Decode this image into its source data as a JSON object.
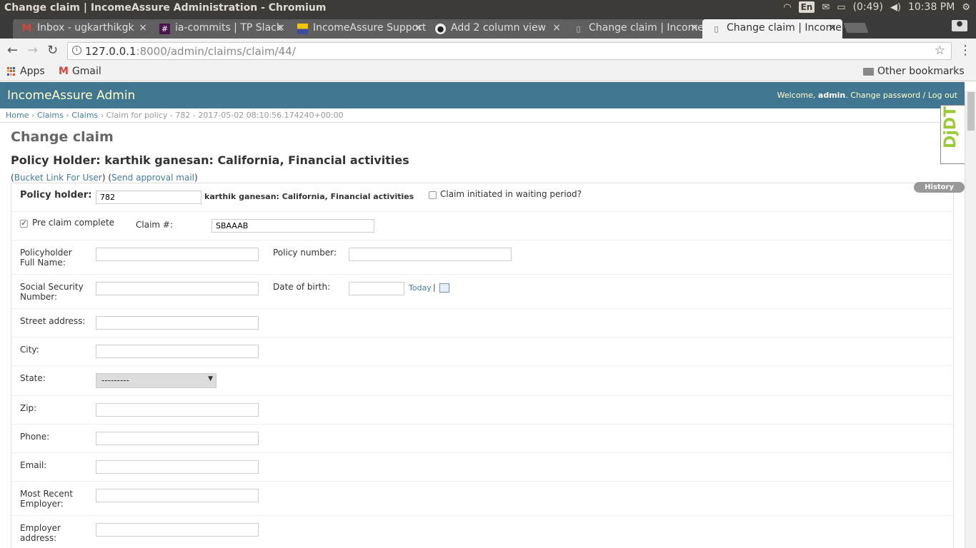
{
  "os": {
    "window_title": "Change claim | IncomeAssure Administration - Chromium",
    "lang": "En",
    "battery": "(0:49)",
    "clock": "10:38 PM"
  },
  "tabs": [
    {
      "label": "Inbox - ugkarthikgk",
      "icon": "gmail-icon"
    },
    {
      "label": "ia-commits | TP Slack",
      "icon": "slack-icon"
    },
    {
      "label": "IncomeAssure Support",
      "icon": "flag-icon"
    },
    {
      "label": "Add 2 column view",
      "icon": "github-icon"
    },
    {
      "label": "Change claim | Income",
      "icon": "page-icon"
    },
    {
      "label": "Change claim | Income",
      "icon": "page-icon"
    }
  ],
  "address": {
    "host": "127.0.0.1",
    "path": ":8000/admin/claims/claim/44/"
  },
  "bookmarks": {
    "apps": "Apps",
    "gmail": "Gmail",
    "other": "Other bookmarks"
  },
  "admin": {
    "brand": "IncomeAssure Admin",
    "welcome": "Welcome, ",
    "username": "admin",
    "change_password": "Change password",
    "sep": " / ",
    "logout": "Log out"
  },
  "breadcrumbs": {
    "home": "Home",
    "claims_app": "Claims",
    "claims_model": "Claims",
    "current": "Claim for policy - 782 - 2017-05-02 08:10:56.174240+00:00"
  },
  "page": {
    "title": "Change claim",
    "subtitle": "Policy Holder: karthik ganesan: California, Financial activities",
    "bucket_link": "Bucket Link For User",
    "approval_link": "Send approval mail",
    "history": "History"
  },
  "form": {
    "policy_holder_label": "Policy holder:",
    "policy_holder_value": "782",
    "policy_holder_desc": "karthik ganesan: California, Financial activities",
    "waiting_period_label": "Claim initiated in waiting period?",
    "pre_claim_label": "Pre claim complete",
    "claim_no_label": "Claim #:",
    "claim_no_value": "SBAAAB",
    "full_name_label_1": "Policyholder",
    "full_name_label_2": "Full Name:",
    "policy_number_label": "Policy number:",
    "ssn_label_1": "Social Security",
    "ssn_label_2": "Number:",
    "dob_label": "Date of birth:",
    "today": "Today",
    "today_sep": " |",
    "street_label": "Street address:",
    "city_label": "City:",
    "state_label": "State:",
    "state_value": "---------",
    "zip_label": "Zip:",
    "phone_label": "Phone:",
    "email_label": "Email:",
    "employer_label_1": "Most Recent",
    "employer_label_2": "Employer:",
    "employer_addr_label_1": "Employer",
    "employer_addr_label_2": "address:"
  },
  "djdt": "DjDT"
}
